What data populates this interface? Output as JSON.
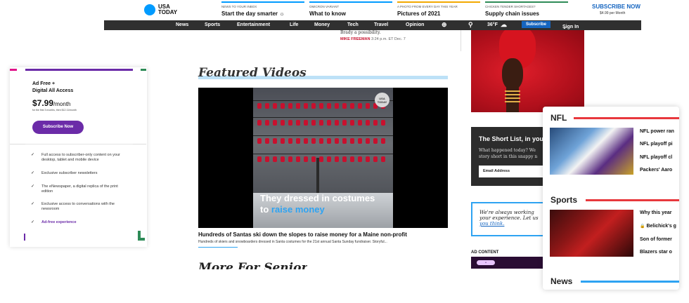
{
  "header": {
    "logo_line1": "USA",
    "logo_line2": "TODAY",
    "promos": [
      {
        "kicker": "NEWS TO YOUR INBOX",
        "title": "Start the day smarter",
        "color": "#009bff"
      },
      {
        "kicker": "OMICRON VARIANT",
        "title": "What to know",
        "color": "#009bff"
      },
      {
        "kicker": "A PHOTO FROM EVERY DAY THIS YEAR",
        "title": "Pictures of 2021",
        "color": "#f2a900"
      },
      {
        "kicker": "CHICKEN TENDER SHORTAGES?",
        "title": "Supply chain issues",
        "color": "#2e8b57"
      }
    ],
    "subscribe_now": "SUBSCRIBE NOW",
    "subscribe_price": "$4.99 per Month"
  },
  "nav": {
    "items": [
      "News",
      "Sports",
      "Entertainment",
      "Life",
      "Money",
      "Tech",
      "Travel",
      "Opinion"
    ],
    "weather": "36°F",
    "subscribe": "Subscribe",
    "sign_in": "Sign In"
  },
  "offer": {
    "title_line1": "Ad Free +",
    "title_line2": "Digital All Access",
    "price": "$7.99",
    "per": "/month",
    "fine_print": "for the first 3 months, then $12.11/month",
    "button": "Subscribe Now",
    "features": [
      "Full access to subscriber-only content on your desktop, tablet and mobile device",
      "Exclusive subscriber newsletters",
      "The eNewspaper, a digital replica of the print edition",
      "Exclusive access to conversations with the newsroom",
      "Ad-free experience"
    ]
  },
  "article": {
    "snippet": "Brady a possibility.",
    "byline_author": "MIKE FREEMAN",
    "byline_time": "3:24 p.m. ET Dec. 7"
  },
  "featured": {
    "section_title": "Featured Videos",
    "video_caption_line1": "They dressed in costumes",
    "video_caption_line2_a": "to ",
    "video_caption_line2_b": "raise money",
    "badge_line1": "USA",
    "badge_line2": "TODAY",
    "headline": "Hundreds of Santas ski down the slopes to raise money for a Maine non-profit",
    "description": "Hundreds of skiers and snowboarders dressed in Santa costumes for the 21st annual Santa Sunday fundraiser. Storyful...",
    "next_section": "More For Senior"
  },
  "right": {
    "shortlist_title": "The Short List, in your",
    "shortlist_text1": "What happened today? We",
    "shortlist_text2": "story short in this snappy n",
    "email_placeholder": "Email Address",
    "feedback_line1": "We're always working",
    "feedback_line2": "your experience. Let us",
    "feedback_line3": "you think.",
    "ad_label": "AD CONTENT"
  },
  "panel": {
    "nfl_title": "NFL",
    "nfl_stories": [
      "NFL power ran",
      "NFL playoff pi",
      "NFL playoff cl",
      "Packers' Aaro"
    ],
    "sports_title": "Sports",
    "sports_stories": [
      "Why this year",
      "Belichick's g",
      "Son of former",
      "Blazers star o"
    ],
    "news_title": "News",
    "accent_red": "#e8383d",
    "accent_blue": "#2ea3f2"
  }
}
